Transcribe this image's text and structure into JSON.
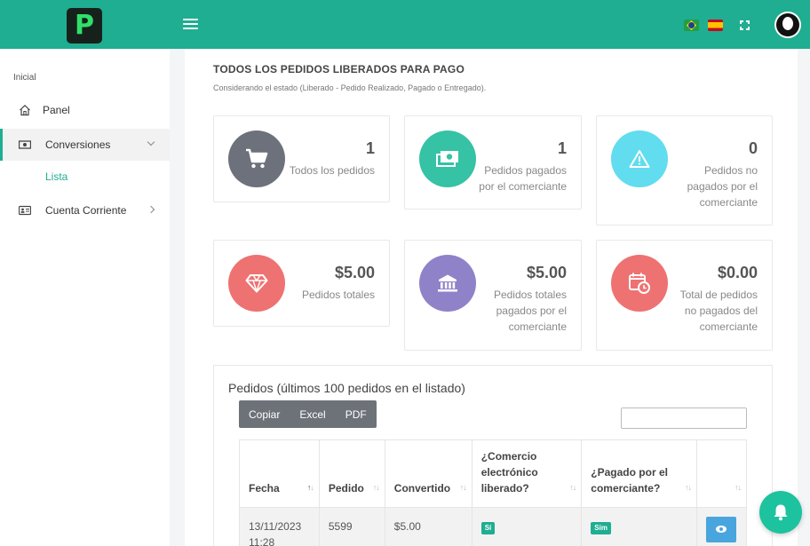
{
  "app": {
    "logo_letter": "P",
    "accent": "#1fae91"
  },
  "sidebar": {
    "section_title": "Inicial",
    "items": [
      {
        "label": "Panel",
        "icon": "home-icon"
      },
      {
        "label": "Conversiones",
        "icon": "money-icon",
        "active": true,
        "expanded": true
      },
      {
        "label": "Cuenta Corriente",
        "icon": "id-card-icon"
      }
    ],
    "sub_items": [
      {
        "label": "Lista"
      }
    ]
  },
  "page": {
    "title": "TODOS LOS PEDIDOS LIBERADOS PARA PAGO",
    "subtitle": "Considerando el estado (Liberado - Pedido Realizado, Pagado o Entregado)."
  },
  "stats": [
    {
      "value": "1",
      "label_lines": [
        "Todos los pedidos"
      ],
      "icon": "cart-icon",
      "color": "#6c717b"
    },
    {
      "value": "1",
      "label_lines": [
        "Pedidos pagados",
        "por el comerciante"
      ],
      "icon": "money-bill-icon",
      "color": "#35c2a5"
    },
    {
      "value": "0",
      "label_lines": [
        "Pedidos no",
        "pagados por el",
        "comerciante"
      ],
      "icon": "warning-icon",
      "color": "#62dcef"
    },
    {
      "value": "$5.00",
      "label_lines": [
        "Pedidos totales"
      ],
      "icon": "diamond-icon",
      "color": "#ee7272"
    },
    {
      "value": "$5.00",
      "label_lines": [
        "Pedidos totales",
        "pagados por el",
        "comerciante"
      ],
      "icon": "bank-icon",
      "color": "#8f82c8"
    },
    {
      "value": "$0.00",
      "label_lines": [
        "Total de pedidos",
        "no pagados del",
        "comerciante"
      ],
      "icon": "calendar-clock-icon",
      "color": "#ee7272"
    }
  ],
  "orders": {
    "title": "Pedidos (últimos 100 pedidos en el listado)",
    "buttons": [
      "Copiar",
      "Excel",
      "PDF"
    ],
    "search_placeholder": "",
    "columns": [
      {
        "lines": [
          "Fecha"
        ]
      },
      {
        "lines": [
          "Pedido"
        ]
      },
      {
        "lines": [
          "Convertido"
        ]
      },
      {
        "lines": [
          "¿Comercio",
          "electrónico",
          "liberado?"
        ]
      },
      {
        "lines": [
          "¿Pagado por el",
          "comerciante?"
        ]
      },
      {
        "lines": [
          ""
        ]
      }
    ],
    "rows": [
      {
        "date_lines": [
          "13/11/2023",
          "11:28"
        ],
        "order": "5599",
        "converted": "$5.00",
        "released": "Sí",
        "paid": "Sim"
      }
    ]
  }
}
